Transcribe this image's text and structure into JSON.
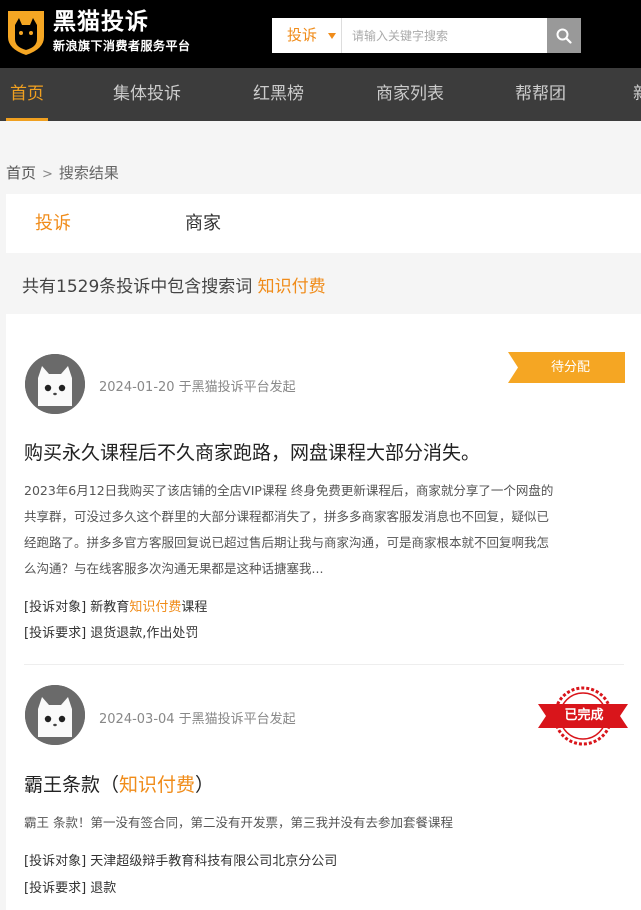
{
  "header": {
    "logo_title": "黑猫投诉",
    "logo_subtitle": "新浪旗下消费者服务平台",
    "search": {
      "type_label": "投诉",
      "placeholder": "请输入关键字搜索"
    }
  },
  "nav": {
    "items": [
      {
        "label": "首页"
      },
      {
        "label": "集体投诉"
      },
      {
        "label": "红黑榜"
      },
      {
        "label": "商家列表"
      },
      {
        "label": "帮帮团"
      },
      {
        "label": "新"
      }
    ]
  },
  "breadcrumb": {
    "home": "首页",
    "separator": ">",
    "current": "搜索结果"
  },
  "tabs": [
    {
      "label": "投诉"
    },
    {
      "label": "商家"
    }
  ],
  "summary": {
    "text": "共有1529条投诉中包含搜索词",
    "keyword": "知识付费"
  },
  "complaints": [
    {
      "date": "2024-01-20 于黑猫投诉平台发起",
      "status": "待分配",
      "title": "购买永久课程后不久商家跑路，网盘课程大部分消失。",
      "desc_lines": [
        "2023年6月12日我购买了该店铺的全店VIP课程 终身免费更新课程后，商家就分享了一个网盘的",
        "共享群，可没过多久这个群里的大部分课程都消失了，拼多多商家客服发消息也不回复，疑似已",
        "经跑路了。拼多多官方客服回复说已超过售后期让我与商家沟通，可是商家根本就不回复啊我怎",
        "么沟通？与在线客服多次沟通无果都是这种话搪塞我..."
      ],
      "target_label": "[投诉对象]",
      "target_pre": "新教育",
      "target_kw": "知识付费",
      "target_post": "课程",
      "demand_label": "[投诉要求]",
      "demand": "退货退款,作出处罚"
    },
    {
      "date": "2024-03-04 于黑猫投诉平台发起",
      "status": "已完成",
      "title_pre": "霸王条款（",
      "title_kw": "知识付费",
      "title_post": "）",
      "desc": "霸王 条款！第一没有签合同，第二没有开发票，第三我并没有去参加套餐课程",
      "target_label": "[投诉对象]",
      "target": "天津超级辩手教育科技有限公司北京分公司",
      "demand_label": "[投诉要求]",
      "demand": "退款"
    }
  ],
  "colors": {
    "accent": "#f08c1a",
    "ribbon": "#f5a623",
    "stamp": "#d9151b",
    "nav_bg": "#3c3c3c",
    "header_bg": "#000000"
  },
  "icons": {
    "logo": "black-cat-shield-icon",
    "search": "search-icon",
    "caret": "caret-down-icon",
    "avatar": "white-cat-avatar-icon"
  }
}
